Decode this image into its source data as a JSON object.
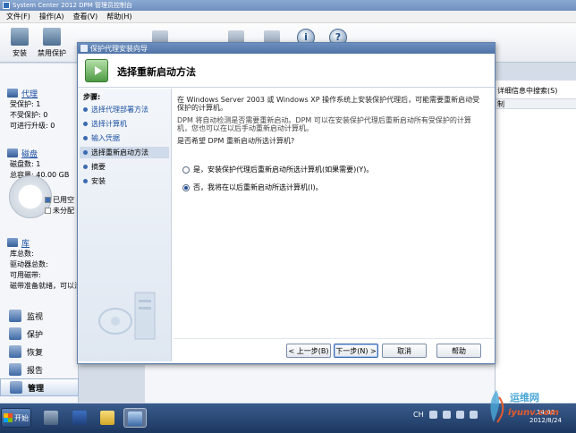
{
  "window": {
    "title": "System Center 2012 DPM 管理员控制台"
  },
  "menu": [
    "文件(F)",
    "操作(A)",
    "查看(V)",
    "帮助(H)"
  ],
  "toolbar": {
    "install": "安装",
    "disable_protection": "禁用保护",
    "info_glyph": "i",
    "help_glyph": "?"
  },
  "nav": {
    "agents": {
      "title": "代理",
      "protected": "受保护:   1",
      "unprotected": "不受保护:   0",
      "upgradeable": "可进行升级:   0"
    },
    "disks": {
      "title": "磁盘",
      "count": "磁盘数: 1",
      "capacity": "总容量:   40.00 GB",
      "used_legend": "已用空",
      "unallocated_legend": "未分配"
    },
    "library": {
      "title": "库",
      "total": "库总数:",
      "drives": "驱动器总数:",
      "available_tapes": "可用磁带:",
      "cleaning_tapes": "磁带准备就绪，可以清"
    },
    "workspaces": [
      {
        "label": "监视",
        "icon": "monitor-icon"
      },
      {
        "label": "保护",
        "icon": "shield-icon"
      },
      {
        "label": "恢复",
        "icon": "recovery-icon"
      },
      {
        "label": "报告",
        "icon": "report-icon"
      },
      {
        "label": "管理",
        "icon": "management-icon",
        "selected": true
      }
    ]
  },
  "right_pane": {
    "search_label": "详细信息中搜索(S)",
    "column": "制"
  },
  "wizard": {
    "title": "保护代理安装向导",
    "heading": "选择重新启动方法",
    "steps_title": "步骤:",
    "steps": [
      {
        "label": "选择代理部署方法",
        "state": "done"
      },
      {
        "label": "选择计算机",
        "state": "done"
      },
      {
        "label": "输入凭据",
        "state": "done"
      },
      {
        "label": "选择重新启动方法",
        "state": "current"
      },
      {
        "label": "摘要",
        "state": "pending"
      },
      {
        "label": "安装",
        "state": "pending"
      }
    ],
    "para1": "在 Windows Server 2003 或 Windows XP 操作系统上安装保护代理后，可能需要重新启动受保护的计算机。",
    "para2": "DPM 将自动检测是否需要重新启动。DPM 可以在安装保护代理后重新启动所有受保护的计算机，您也可以在以后手动重新启动计算机。",
    "question": "是否希望 DPM 重新启动所选计算机?",
    "option_yes": "是，安装保护代理后重新启动所选计算机(如果需要)(Y)。",
    "option_no": "否，我将在以后重新启动所选计算机(I)。",
    "selected_option": "no",
    "buttons": {
      "back": "< 上一步(B)",
      "next": "下一步(N) >",
      "cancel": "取消",
      "help": "帮助"
    }
  },
  "taskbar": {
    "start": "开始",
    "lang": "CH",
    "time": "14:06",
    "date": "2012/8/24"
  },
  "watermark": {
    "text": "运维网",
    "sub": "iyunv.com"
  },
  "colors": {
    "accent": "#1a4ea0",
    "title_bar": "#6d8fbf",
    "taskbar": "#1c3760"
  }
}
